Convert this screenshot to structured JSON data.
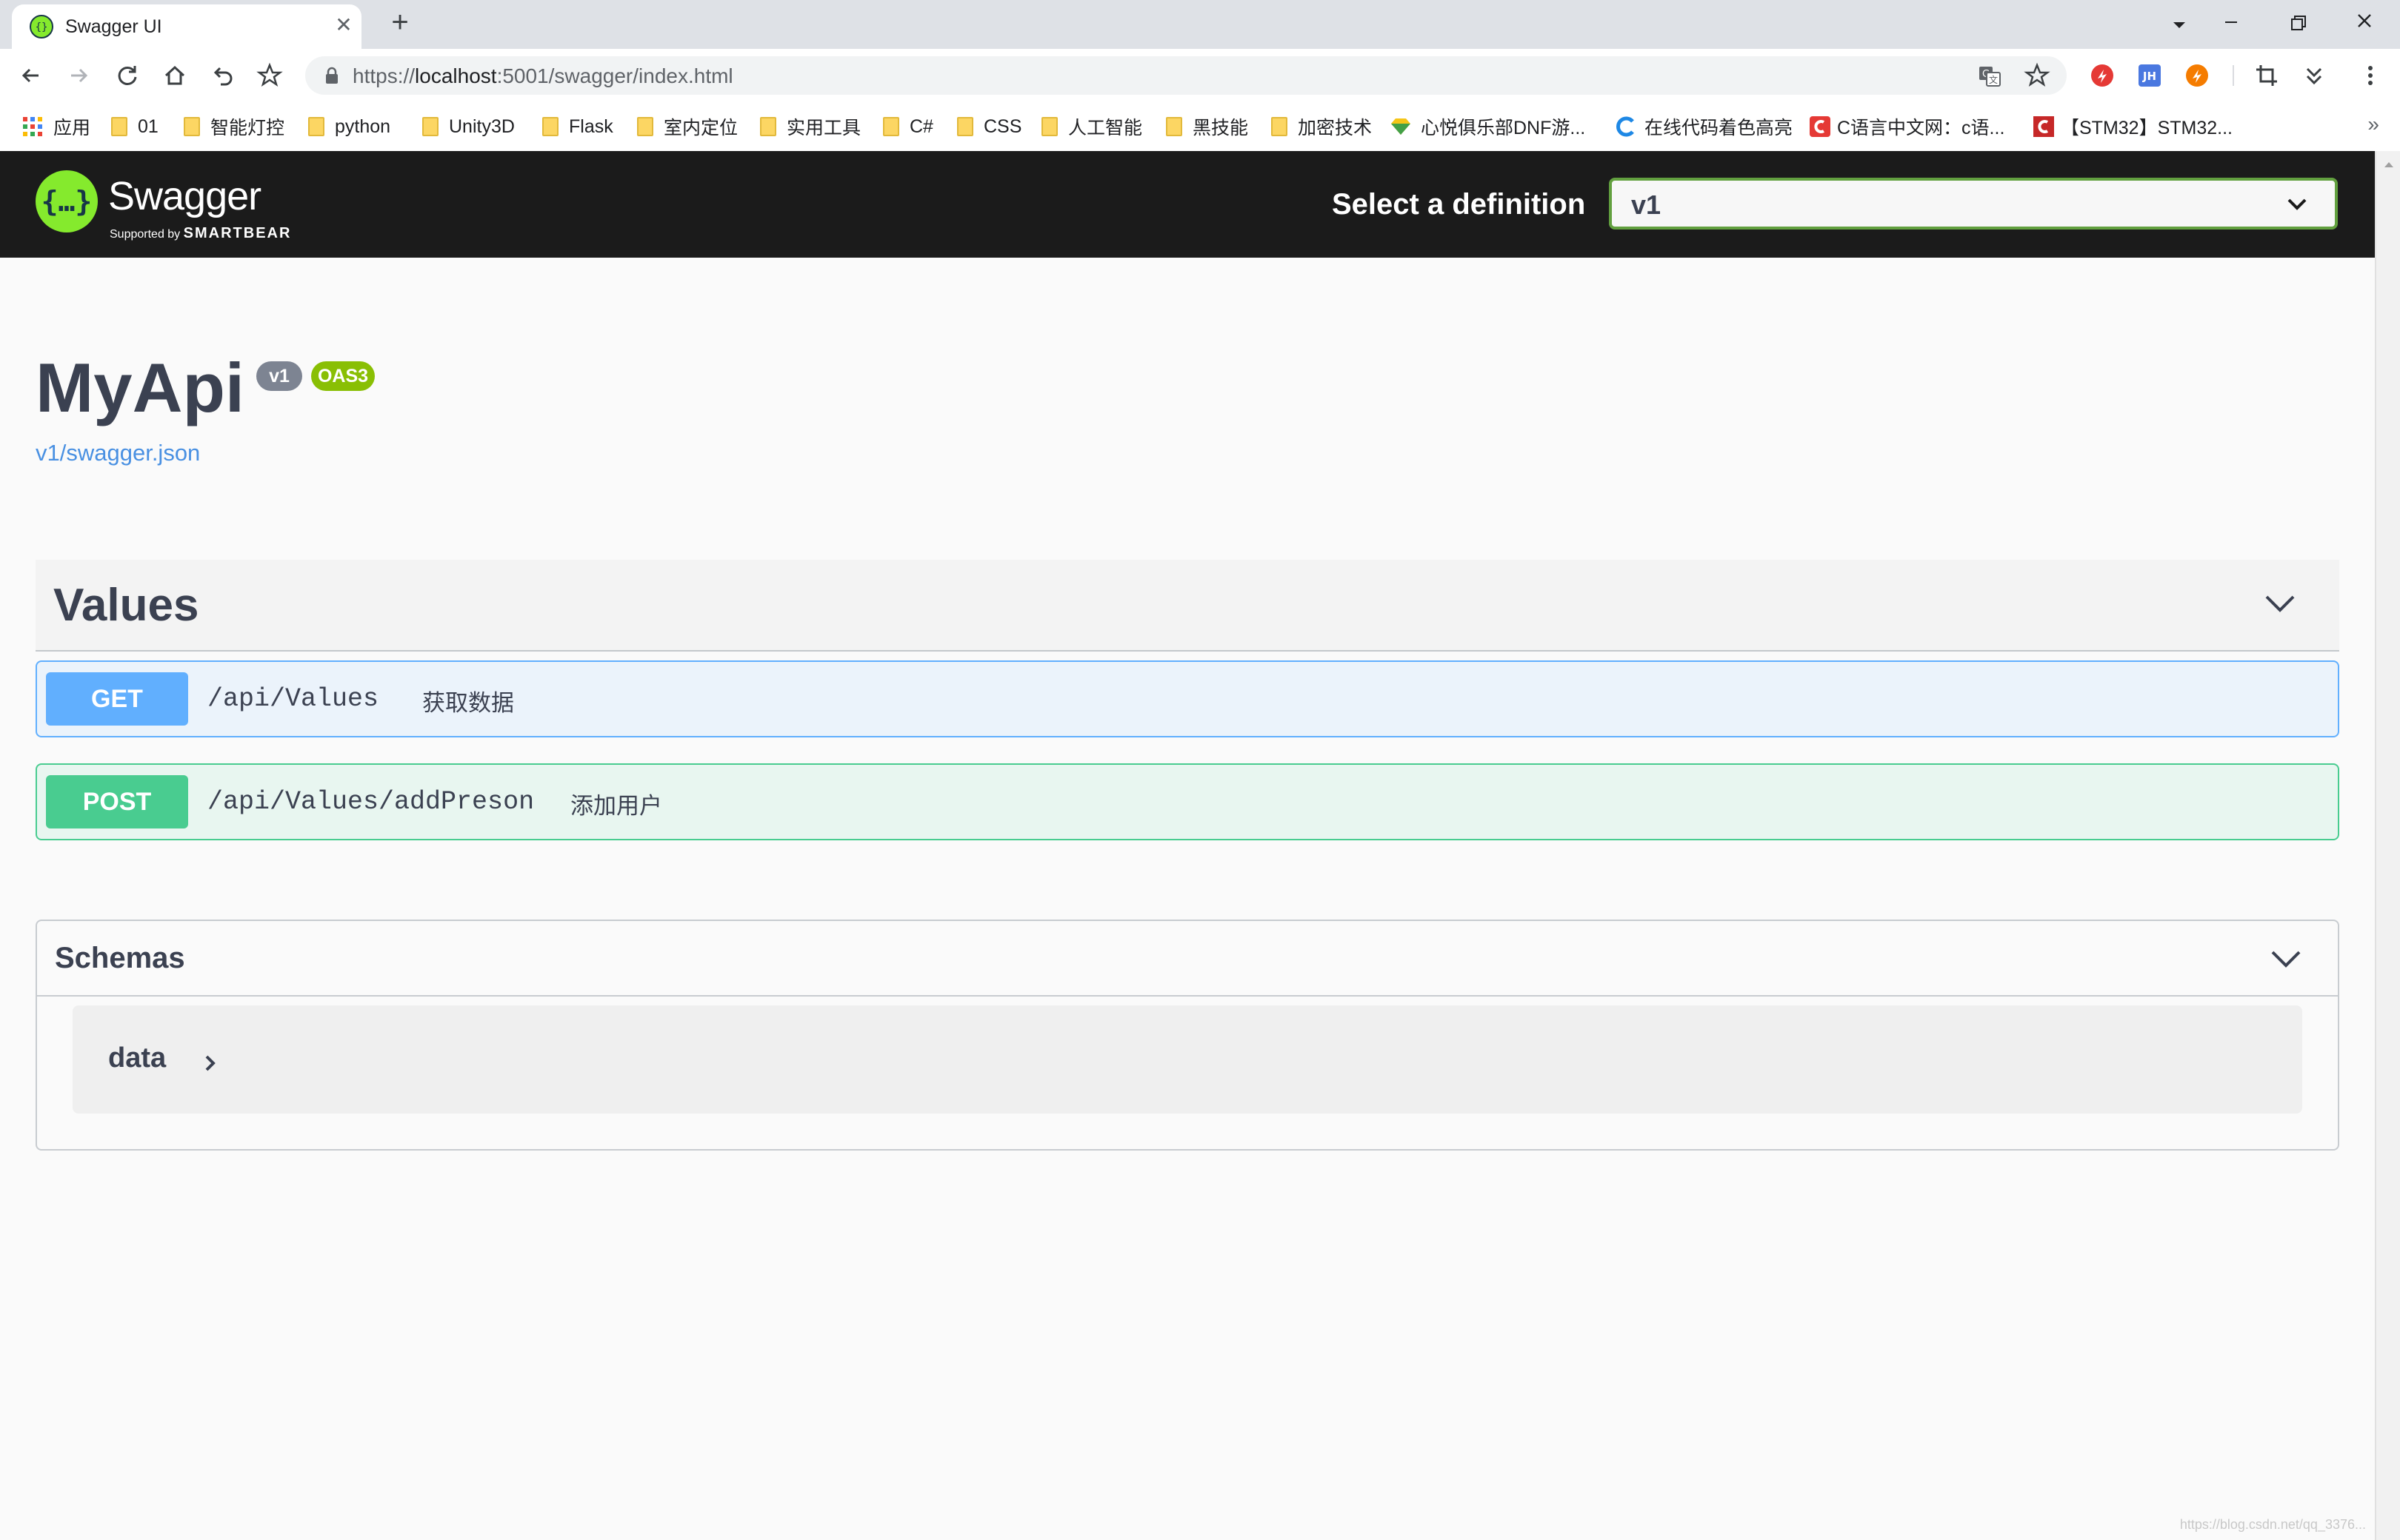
{
  "browser": {
    "tab_title": "Swagger UI",
    "url_scheme": "https://",
    "url_host": "localhost",
    "url_rest": ":5001/swagger/index.html",
    "bookmarks": [
      {
        "label": "应用",
        "icon": "apps-grid-icon"
      },
      {
        "label": "01",
        "icon": "folder-icon"
      },
      {
        "label": "智能灯控",
        "icon": "folder-icon"
      },
      {
        "label": "python",
        "icon": "folder-icon"
      },
      {
        "label": "Unity3D",
        "icon": "folder-icon"
      },
      {
        "label": "Flask",
        "icon": "folder-icon"
      },
      {
        "label": "室内定位",
        "icon": "folder-icon"
      },
      {
        "label": "实用工具",
        "icon": "folder-icon"
      },
      {
        "label": "C#",
        "icon": "folder-icon"
      },
      {
        "label": "CSS",
        "icon": "folder-icon"
      },
      {
        "label": "人工智能",
        "icon": "folder-icon"
      },
      {
        "label": "黑技能",
        "icon": "folder-icon"
      },
      {
        "label": "加密技术",
        "icon": "folder-icon"
      },
      {
        "label": "心悦俱乐部DNF游...",
        "icon": "gem-icon"
      },
      {
        "label": "在线代码着色高亮",
        "icon": "c-logo-icon"
      },
      {
        "label": "C语言中文网：c语...",
        "icon": "c-red-icon"
      },
      {
        "label": "【STM32】STM32...",
        "icon": "csdn-icon"
      }
    ],
    "overflow": "»"
  },
  "swagger": {
    "logo_text": "Swagger",
    "logo_sub_prefix": "Supported by",
    "logo_sub_brand": "SMARTBEAR",
    "definition_label": "Select a definition",
    "definition_value": "v1",
    "info": {
      "title": "MyApi",
      "version_badge": "v1",
      "oas_badge": "OAS3",
      "spec_link": "v1/swagger.json"
    },
    "tag": "Values",
    "operations": [
      {
        "method": "GET",
        "path": "/api/Values",
        "summary": "获取数据"
      },
      {
        "method": "POST",
        "path": "/api/Values/addPreson",
        "summary": "添加用户"
      }
    ],
    "schemas_title": "Schemas",
    "schemas": [
      {
        "name": "data"
      }
    ]
  },
  "colors": {
    "topbar": "#1b1b1b",
    "get": "#61affe",
    "post": "#49cc90",
    "select_border": "#62a03f"
  },
  "watermark": "https://blog.csdn.net/qq_3376..."
}
